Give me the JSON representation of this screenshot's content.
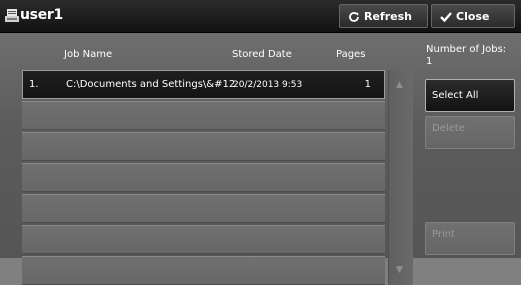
{
  "window": {
    "title": "user1"
  },
  "toolbar": {
    "refresh_label": "Refresh",
    "close_label": "Close"
  },
  "table": {
    "headers": {
      "job_name": "Job Name",
      "stored_date": "Stored Date",
      "pages": "Pages"
    },
    "rows": [
      {
        "no": "1.",
        "job_name": "C:\\Documents and Settings\\&#12",
        "stored_date": "20/2/2013 9:53",
        "pages": "1"
      }
    ]
  },
  "side": {
    "number_of_jobs_label": "Number of Jobs:",
    "number_of_jobs_value": "1",
    "select_all_label": "Select All",
    "delete_label": "Delete",
    "print_label": "Print"
  },
  "colors": {
    "background": "#5e5e5e",
    "titlebar": "#1c1c1c",
    "selected_row": "#1a1a1a"
  }
}
